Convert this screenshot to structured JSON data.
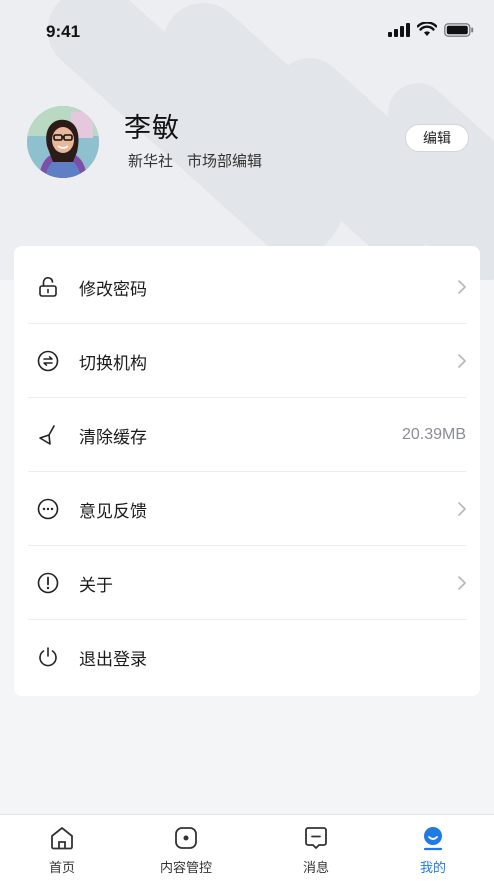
{
  "status_bar": {
    "time": "9:41"
  },
  "profile": {
    "name": "李敏",
    "organization": "新华社",
    "position": "市场部编辑",
    "edit_label": "编辑"
  },
  "menu": [
    {
      "label": "修改密码",
      "icon": "lock-open-icon"
    },
    {
      "label": "切换机构",
      "icon": "switch-icon"
    },
    {
      "label": "清除缓存",
      "icon": "broom-icon",
      "value": "20.39MB"
    },
    {
      "label": "意见反馈",
      "icon": "feedback-icon"
    },
    {
      "label": "关于",
      "icon": "info-icon"
    },
    {
      "label": "退出登录",
      "icon": "power-icon"
    }
  ],
  "tabbar": [
    {
      "label": "首页",
      "icon": "home-icon"
    },
    {
      "label": "内容管控",
      "icon": "content-control-icon"
    },
    {
      "label": "消息",
      "icon": "message-icon"
    },
    {
      "label": "我的",
      "icon": "profile-icon",
      "active": true
    }
  ],
  "colors": {
    "accent": "#1f7ae6",
    "background": "#f4f5f7",
    "hero": "#eceef2"
  }
}
